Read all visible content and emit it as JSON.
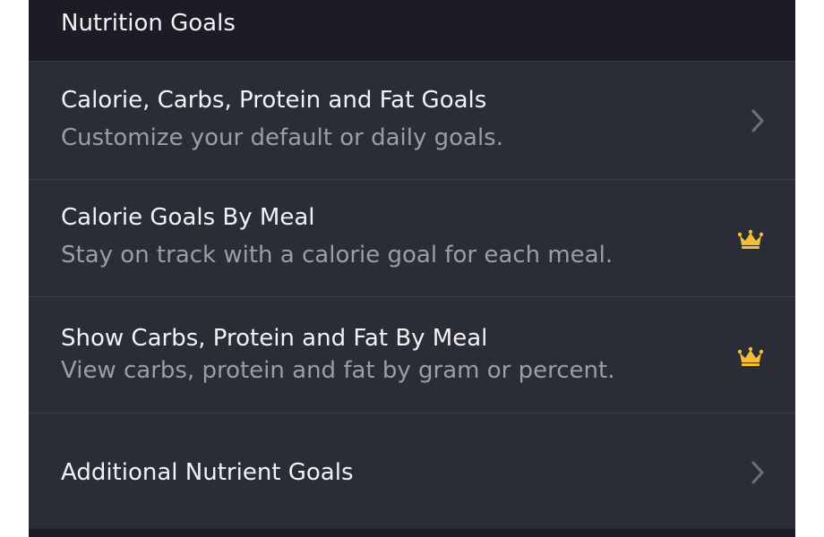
{
  "header": {
    "title": "Nutrition Goals"
  },
  "rows": [
    {
      "title": "Calorie, Carbs, Protein and Fat Goals",
      "subtitle": "Customize your default or daily goals.",
      "accessory": "chevron-right-icon"
    },
    {
      "title": "Calorie Goals By Meal",
      "subtitle": "Stay on track with a calorie goal for each meal.",
      "accessory": "crown-icon"
    },
    {
      "title": "Show Carbs, Protein and Fat By Meal",
      "subtitle": "View carbs, protein and fat by gram or percent.",
      "accessory": "crown-icon"
    },
    {
      "title": "Additional Nutrient Goals",
      "subtitle": "",
      "accessory": "chevron-right-icon"
    }
  ],
  "colors": {
    "background": "#2a2c36",
    "header_background": "#1b1c25",
    "primary_text": "#f2f2f4",
    "secondary_text": "#9c9da6",
    "premium_crown": "#f5bd36",
    "chevron": "#6e707a"
  }
}
